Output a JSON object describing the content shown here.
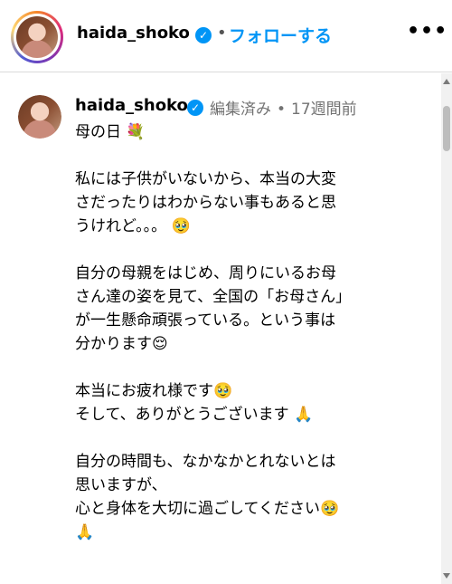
{
  "post_header": {
    "username": "haida_shoko",
    "verified_glyph": "✓",
    "separator": "•",
    "follow_label": "フォローする",
    "more_glyph": "•••"
  },
  "comment": {
    "username": "haida_shoko",
    "verified_glyph": "✓",
    "edited_label": "編集済み",
    "separator": "•",
    "time_ago": "17週間前",
    "paragraphs": [
      [
        "母の日 💐"
      ],
      [
        "私には子供がいないから、本当の大変",
        "さだったりはわからない事もあると思",
        "うけれど。。。 🥹"
      ],
      [
        "自分の母親をはじめ、周りにいるお母",
        "さん達の姿を見て、全国の「お母さん」",
        "が一生懸命頑張っている。という事は",
        "分かります😌"
      ],
      [
        "本当にお疲れ様です🥹",
        "そして、ありがとうございます 🙏"
      ],
      [
        "自分の時間も、なかなかとれないとは",
        "思いますが、",
        "心と身体を大切に過ごしてください🥹",
        "🙏"
      ]
    ]
  },
  "icons": {
    "verified": "verified-badge-icon",
    "more": "more-options-icon",
    "scroll_up": "scroll-up-arrow-icon",
    "scroll_down": "scroll-down-arrow-icon"
  },
  "colors": {
    "accent": "#0095f6",
    "meta_text": "#737373",
    "divider": "#dbdbdb"
  }
}
